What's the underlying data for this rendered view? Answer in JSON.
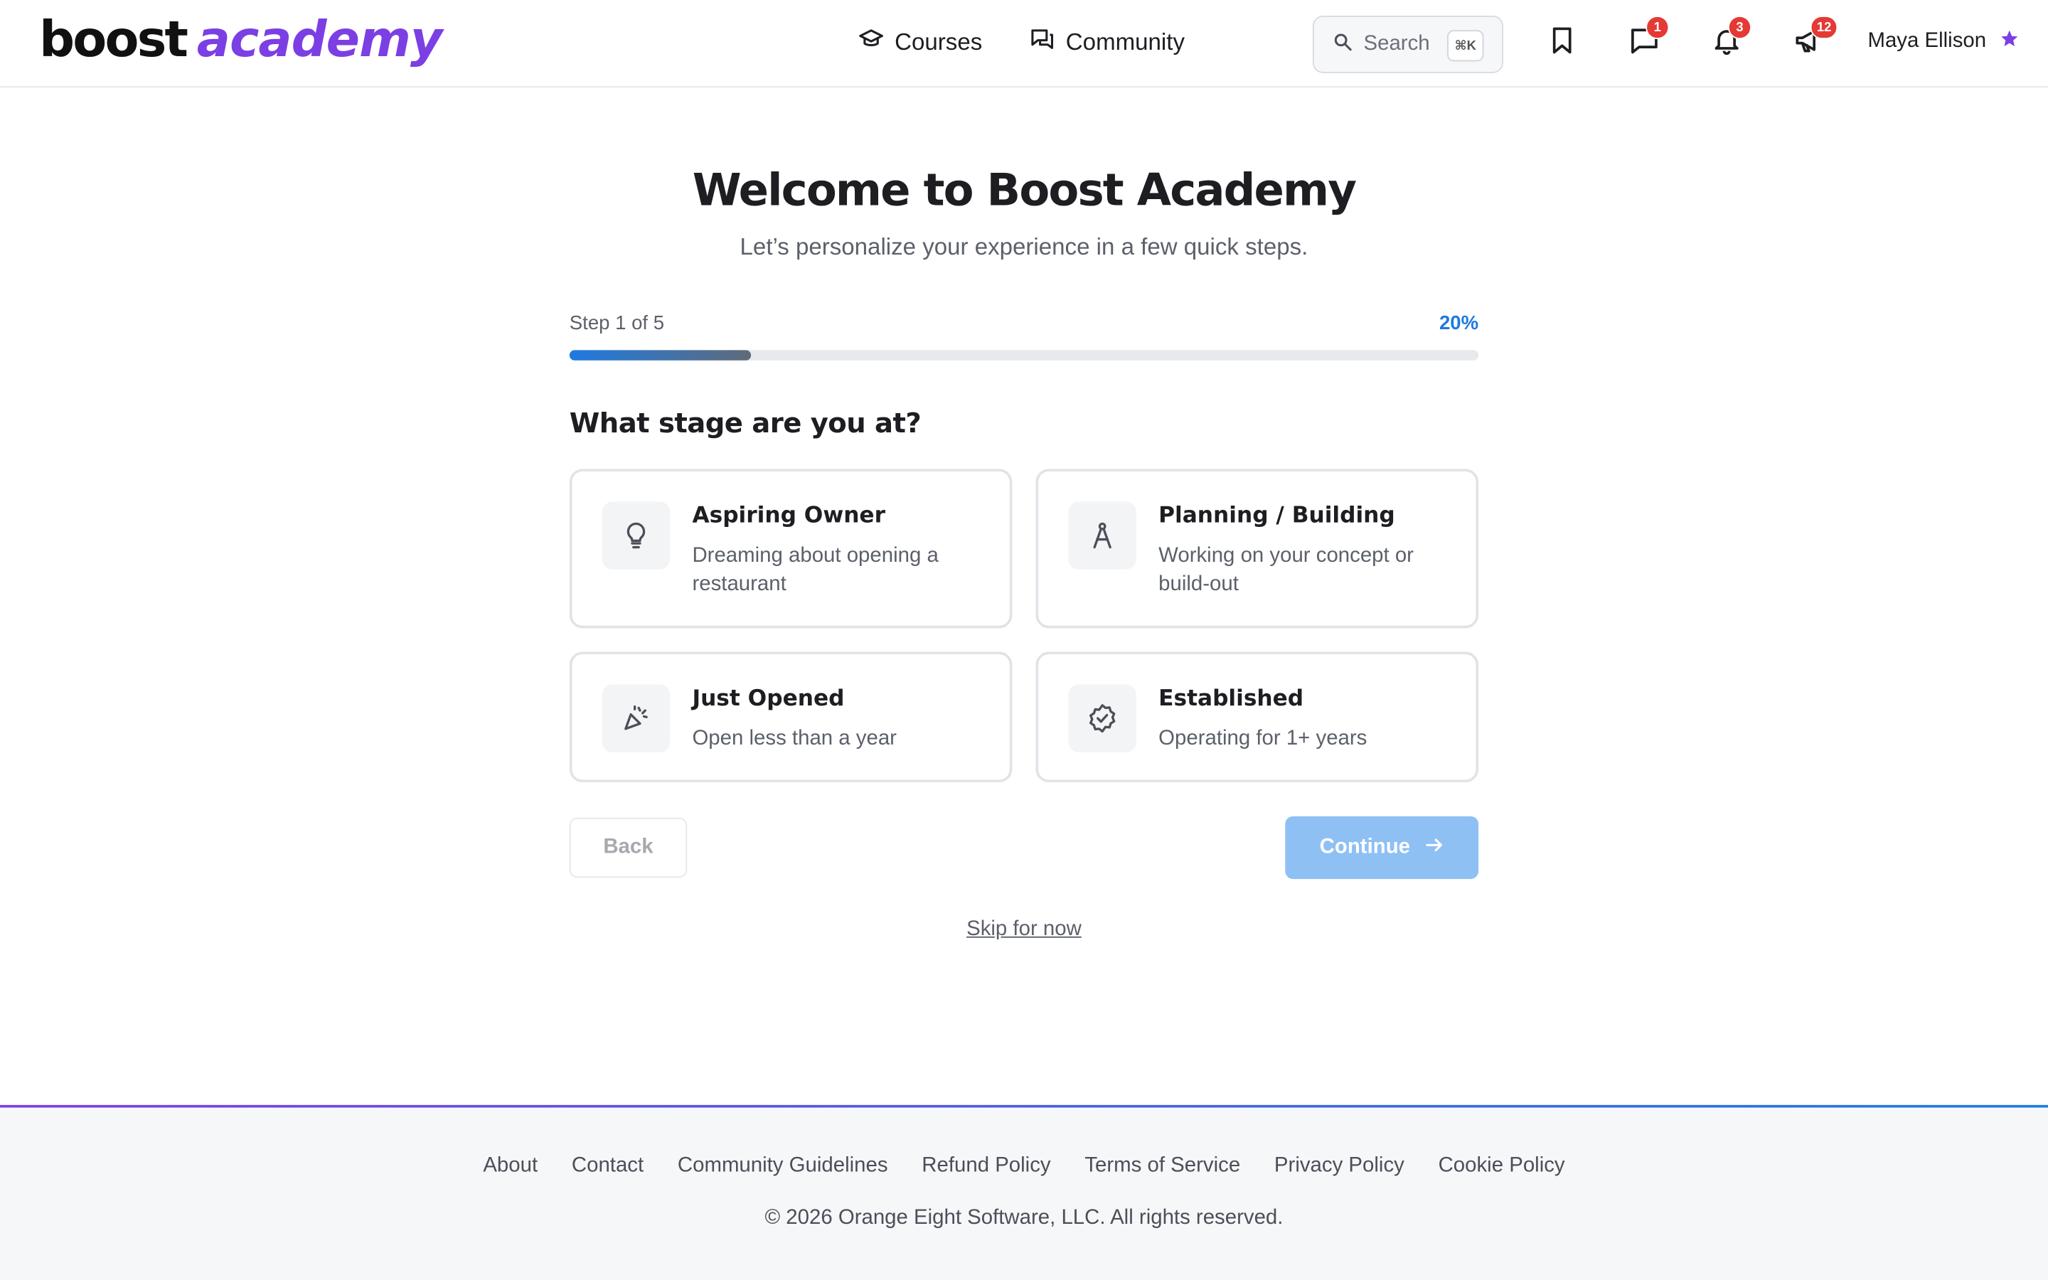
{
  "header": {
    "logo_part1": "boost",
    "logo_part2": "academy",
    "nav": [
      {
        "label": "Courses",
        "icon": "graduation-cap-icon"
      },
      {
        "label": "Community",
        "icon": "chat-bubbles-icon"
      }
    ],
    "search_label": "Search",
    "search_shortcut": "⌘K",
    "badges": {
      "messages": "1",
      "notifications": "3",
      "announcements": "12"
    },
    "user_name": "Maya Ellison"
  },
  "main": {
    "title": "Welcome to Boost Academy",
    "subtitle": "Let’s personalize your experience in a few quick steps.",
    "step_label": "Step 1 of 5",
    "step_percent": "20%",
    "progress_fraction": 0.2,
    "question": "What stage are you at?",
    "options": [
      {
        "title": "Aspiring Owner",
        "description": "Dreaming about opening a restaurant",
        "icon": "lightbulb-icon"
      },
      {
        "title": "Planning / Building",
        "description": "Working on your concept or build-out",
        "icon": "compass-icon"
      },
      {
        "title": "Just Opened",
        "description": "Open less than a year",
        "icon": "party-popper-icon"
      },
      {
        "title": "Established",
        "description": "Operating for 1+ years",
        "icon": "verified-badge-icon"
      }
    ],
    "back_label": "Back",
    "continue_label": "Continue",
    "skip_label": "Skip for now"
  },
  "footer": {
    "links": [
      "About",
      "Contact",
      "Community Guidelines",
      "Refund Policy",
      "Terms of Service",
      "Privacy Policy",
      "Cookie Policy"
    ],
    "copyright": "© 2026 Orange Eight Software, LLC. All rights reserved."
  },
  "colors": {
    "brand_purple": "#7b3fe4",
    "accent_blue": "#1f7ae0",
    "badge_red": "#e53935",
    "continue_disabled": "#8ec0f4"
  }
}
